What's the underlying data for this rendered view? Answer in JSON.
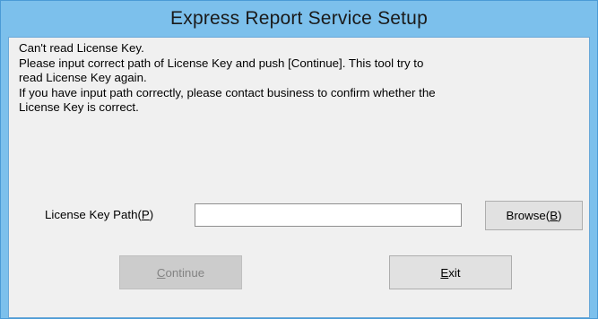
{
  "window": {
    "title": "Express Report Service Setup"
  },
  "message": {
    "lines": [
      "Can't read License Key.",
      "Please input correct path of License Key and push [Continue]. This tool try to",
      "read License Key again.",
      "If you have input path correctly, please contact business to confirm whether the",
      "License Key is correct."
    ]
  },
  "license_path": {
    "label_prefix": "License Key Path(",
    "label_mnemonic": "P",
    "label_suffix": ")",
    "value": ""
  },
  "buttons": {
    "browse": {
      "prefix": "Browse(",
      "mnemonic": "B",
      "suffix": ")"
    },
    "continue": {
      "mnemonic": "C",
      "rest": "ontinue",
      "enabled": false
    },
    "exit": {
      "mnemonic": "E",
      "rest": "xit"
    }
  },
  "colors": {
    "title_bar": "#7cc0ec",
    "client_bg": "#f0f0f0",
    "button_bg": "#e1e1e1",
    "disabled_text": "#838383"
  }
}
